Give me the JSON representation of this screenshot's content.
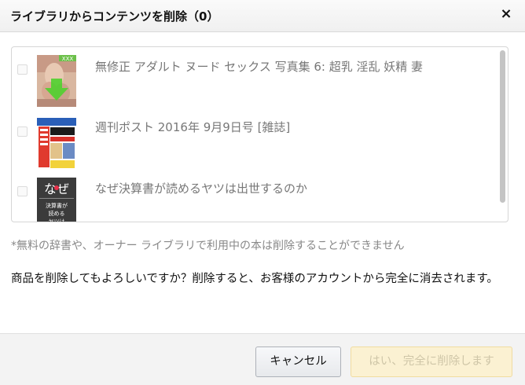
{
  "dialog": {
    "title": "ライブラリからコンテンツを削除（0）",
    "close_glyph": "×"
  },
  "items": [
    {
      "title": "無修正 アダルト ヌード セックス 写真集 6: 超乳 淫乱 妖精 妻",
      "checked": false,
      "thumb_badge": "XXX"
    },
    {
      "title": "週刊ポスト 2016年 9月9日号 [雑誌]",
      "checked": false
    },
    {
      "title": "なぜ決算書が読めるヤツは出世するのか",
      "checked": false,
      "thumb_text_top": "なぜ",
      "thumb_text_bottom": "決算書が読めるヤツは"
    }
  ],
  "note": "*無料の辞書や、オーナー ライブラリで利用中の本は削除することができません",
  "question": "商品を削除してもよろしいですか？削除すると、お客様のアカウントから完全に消去されます。",
  "buttons": {
    "cancel": "キャンセル",
    "confirm": "はい、完全に削除します",
    "confirm_enabled": false
  },
  "colors": {
    "confirm_bg": "#fbf1d2",
    "confirm_text": "#cfc6a8",
    "header_bg": "#f2f2f2"
  }
}
